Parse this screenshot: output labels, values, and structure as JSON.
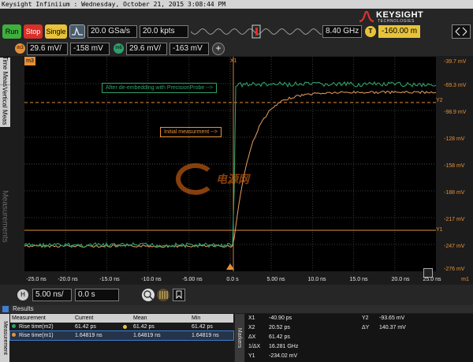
{
  "window": {
    "title": "Keysight Infiniium : Wednesday, October 21, 2015 3:08:44 PM"
  },
  "brand": {
    "name": "KEYSIGHT",
    "subtitle": "TECHNOLOGIES"
  },
  "colors": {
    "accent_orange": "#e69138",
    "trace_green": "#2fa06a",
    "run_green": "#3fae3f",
    "stop_red": "#d9302a",
    "single_yellow": "#e8c33a"
  },
  "toolbar": {
    "run": "Run",
    "stop": "Stop",
    "single": "Single",
    "sample_rate": "20.0 GSa/s",
    "memory_depth": "20.0 kpts",
    "bandwidth": "8.40 GHz",
    "trigger_badge": "T",
    "trigger_level": "-160.00 m",
    "m3_badge": "m3",
    "m3_scale": "29.6 mV/",
    "m3_offset": "-158 mV",
    "m6_badge": "m6",
    "m6_scale": "29.6 mV/",
    "m6_offset": "-163 mV",
    "add_icon": "plus-icon",
    "autoscale_icon": "autoscale-icon"
  },
  "sidebar": {
    "tabs": [
      "Time Meas",
      "Vertical Meas",
      "Measurements"
    ]
  },
  "scope": {
    "channel_tag": "m3",
    "x1_marker": "X1",
    "y1_marker": "Y1",
    "y2_marker": "Y2",
    "annotation_green": "After de-embedding with PrecisionProbe -->",
    "annotation_orange": "Initial measurment -->",
    "y_axis_labels": [
      "-39.7 mV",
      "-69.3 mV",
      "-98.9 mV",
      "-128 mV",
      "-158 mV",
      "-188 mV",
      "-217 mV",
      "-247 mV",
      "-276 mV"
    ],
    "x_axis_labels": [
      "-25.0 ns",
      "-20.0 ns",
      "-15.0 ns",
      "-10.0 ns",
      "-5.00 ns",
      "0.0 s",
      "5.00 ns",
      "10.0 ns",
      "15.0 ns",
      "20.0 ns",
      "25.0 ns"
    ],
    "x_axis_channel": "m1",
    "watermark": "电源网"
  },
  "horizontal": {
    "badge": "H",
    "scale": "5.00 ns/",
    "position": "0.0 s"
  },
  "results": {
    "title": "Results",
    "side_label": "Measurement",
    "headers": [
      "Measurement",
      "Current",
      "Mean",
      "Min"
    ],
    "rows": [
      {
        "name": "Rise time(m2)",
        "current": "61.42 ps",
        "mean": "61.42 ps",
        "min": "61.42 ps"
      },
      {
        "name": "Rise time(m1)",
        "current": "1.64819 ns",
        "mean": "1.64819 ns",
        "min": "1.64819 ns"
      }
    ]
  },
  "markers": {
    "side_label": "Markers",
    "left": [
      {
        "label": "X1",
        "value": "-40.90 ps"
      },
      {
        "label": "X2",
        "value": "20.52 ps"
      },
      {
        "label": "ΔX",
        "value": "61.42 ps"
      },
      {
        "label": "1/ΔX",
        "value": "16.281 GHz"
      },
      {
        "label": "Y1",
        "value": "-234.02 mV"
      }
    ],
    "right": [
      {
        "label": "Y2",
        "value": "-93.65 mV"
      },
      {
        "label": "ΔY",
        "value": "140.37 mV"
      }
    ]
  }
}
